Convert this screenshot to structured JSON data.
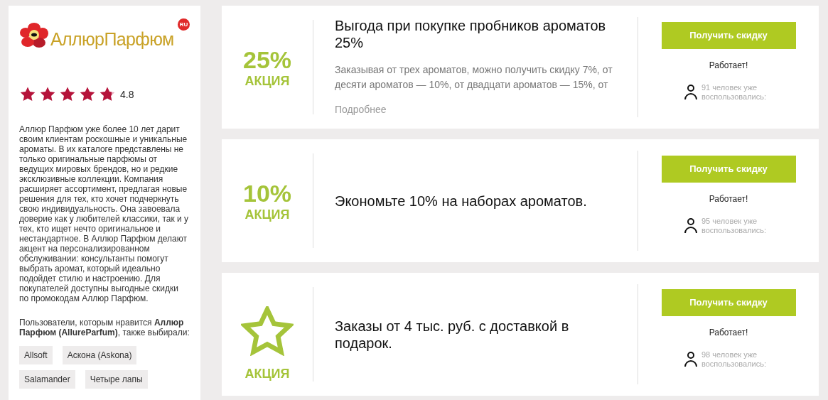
{
  "sidebar": {
    "logo": {
      "text": "АллюрПарфюм",
      "badge": "RU"
    },
    "rating": {
      "stars": 4.8,
      "value": "4.8"
    },
    "description": "Аллюр Парфюм уже более 10 лет дарит своим клиентам роскошные и уникальные ароматы. В их каталоге представлены не только оригинальные парфюмы от ведущих мировых брендов, но и редкие эксклюзивные коллекции. Компания расширяет ассортимент, предлагая новые решения для тех, кто хочет подчеркнуть свою индивидуальность. Она завоевала доверие как у любителей классики, так и у тех, кто ищет нечто оригинальное и нестандартное. В Аллюр Парфюм делают акцент на персонализированном обслуживании: консультанты помогут выбрать аромат, который идеально подойдет стилю и настроению. Для покупателей доступны выгодные скидки по промокодам Аллюр Парфюм.",
    "also_title": "Пользователи, которым нравится **Аллюр Парфюм (AllureParfum)**, также выбирали:",
    "tags": [
      "Allsoft",
      "Аскона (Askona)",
      "Salamander",
      "Четыре лапы"
    ]
  },
  "offers": [
    {
      "kind": "percent",
      "value": "25%",
      "label": "АКЦИЯ",
      "title": "Выгода при покупке пробников ароматов 25%",
      "description": "Заказывая от трех ароматов, можно получить скидку 7%, от десяти ароматов — 10%, от двадцати ароматов — 15%, от",
      "more": "Подробнее",
      "button": "Получить скидку",
      "status": "Работает!",
      "users": "91 человек уже воспользовались:"
    },
    {
      "kind": "percent",
      "value": "10%",
      "label": "АКЦИЯ",
      "title": "Экономьте 10% на наборах ароматов.",
      "button": "Получить скидку",
      "status": "Работает!",
      "users": "95 человек уже воспользовались:"
    },
    {
      "kind": "star",
      "label": "АКЦИЯ",
      "title": "Заказы от 4 тыс. руб. с доставкой в подарок.",
      "button": "Получить скидку",
      "status": "Работает!",
      "users": "98 человек уже воспользовались:"
    }
  ]
}
